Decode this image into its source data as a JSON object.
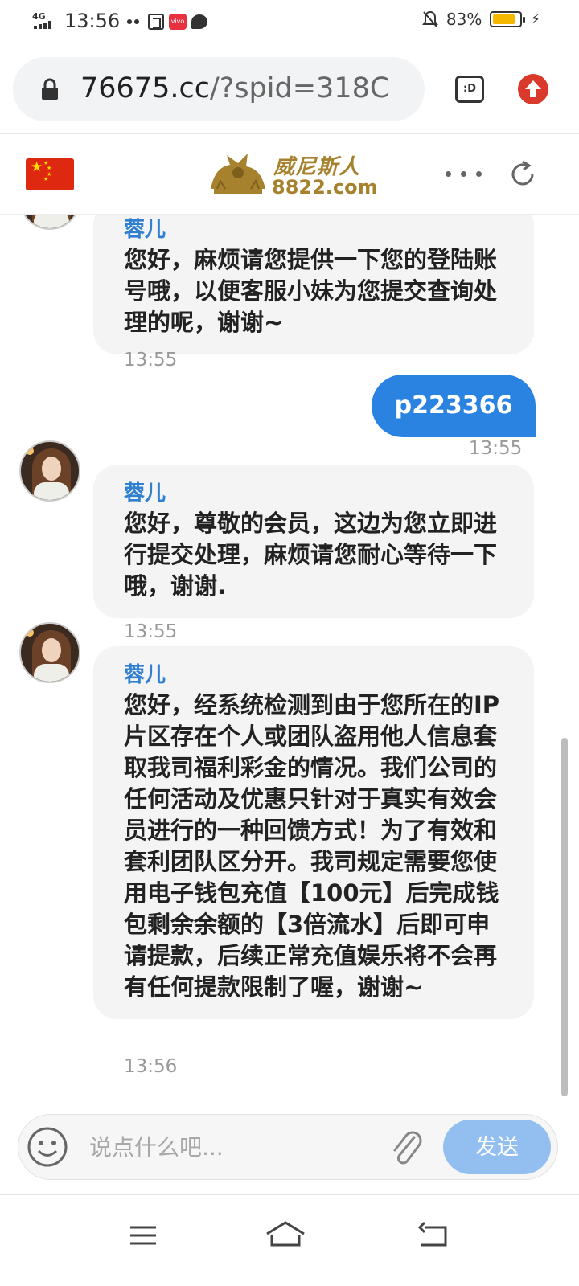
{
  "status_bar": {
    "network": "4G",
    "time": "13:56",
    "battery_percent": "83%",
    "battery_level": 0.83,
    "notification_badge": "vivo"
  },
  "browser": {
    "url_domain": "76675.cc",
    "url_rest": "/?spid=318C",
    "tabs_label": ":D"
  },
  "site": {
    "logo_cn": "威尼斯人",
    "logo_en": "8822.com"
  },
  "chat": {
    "messages": [
      {
        "sender": "蓉儿",
        "text": "您好，麻烦请您提供一下您的登陆账号哦，以便客服小妹为您提交查询处理的呢，谢谢~",
        "time": "13:55"
      },
      {
        "outgoing_text": "p223366",
        "time": "13:55"
      },
      {
        "sender": "蓉儿",
        "text": "您好，尊敬的会员，这边为您立即进行提交处理，麻烦请您耐心等待一下哦，谢谢.",
        "time": "13:55"
      },
      {
        "sender": "蓉儿",
        "text": "您好，经系统检测到由于您所在的IP片区存在个人或团队盗用他人信息套取我司福利彩金的情况。我们公司的任何活动及优惠只针对于真实有效会员进行的一种回馈方式！为了有效和套利团队区分开。我司规定需要您使用电子钱包充值【100元】后完成钱包剩余余额的【3倍流水】后即可申请提款，后续正常充值娱乐将不会再有任何提款限制了喔，谢谢~",
        "time": "13:56"
      }
    ]
  },
  "composer": {
    "placeholder": "说点什么吧...",
    "send_label": "发送"
  },
  "colors": {
    "accent_blue": "#2a83e0",
    "sender_blue": "#2f80d0",
    "send_disabled": "#93bff0",
    "logo_gold": "#a7822e",
    "bubble_gray": "#f4f4f4"
  },
  "icons": [
    "lock-icon",
    "tabs-icon",
    "update-icon",
    "flag-icon",
    "more-icon",
    "refresh-icon",
    "emoji-icon",
    "attach-icon",
    "menu-icon",
    "home-icon",
    "back-icon"
  ]
}
